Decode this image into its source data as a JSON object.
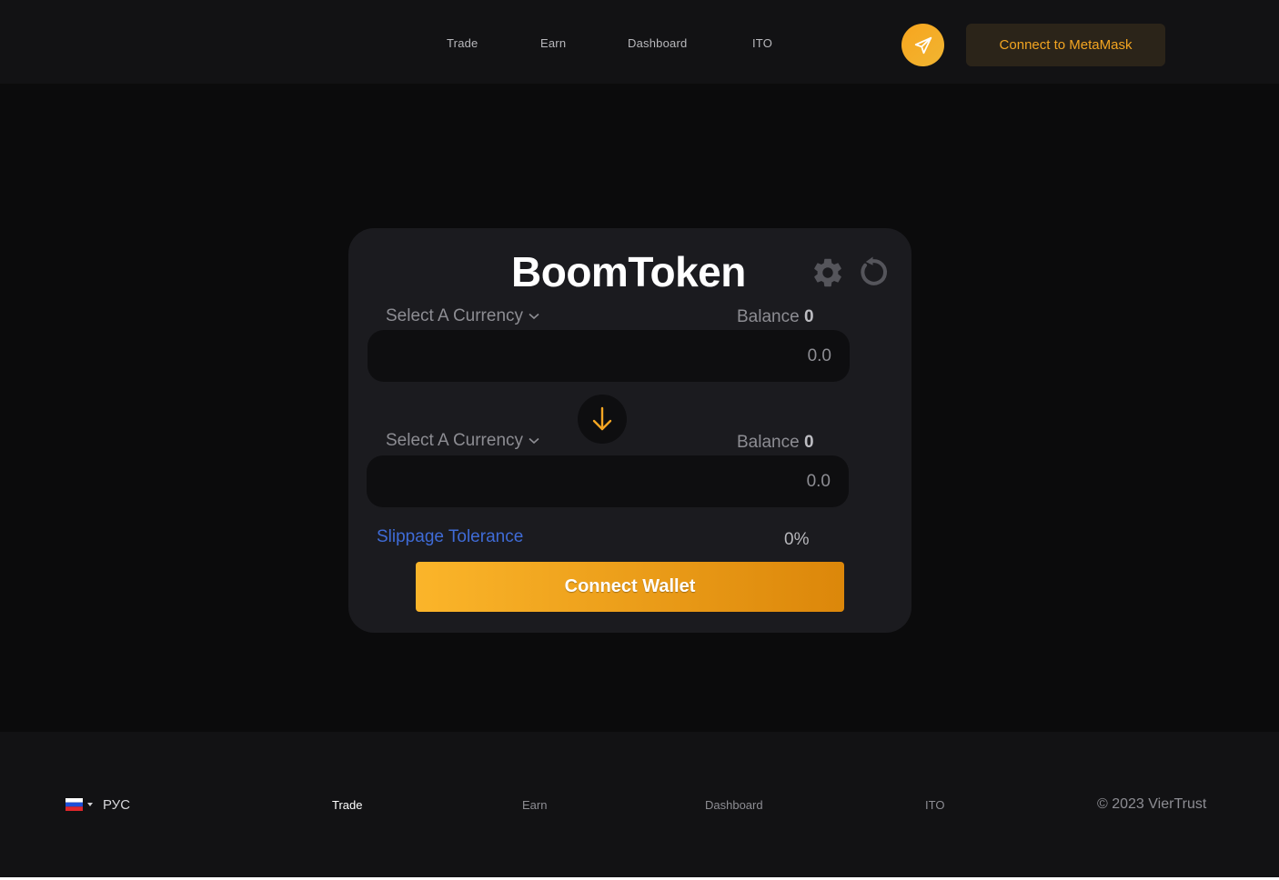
{
  "header": {
    "nav": [
      "Trade",
      "Earn",
      "Dashboard",
      "ITO"
    ],
    "telegram_icon": "paper-plane-icon",
    "connect_metamask": "Connect to MetaMask"
  },
  "swap": {
    "title": "BoomToken",
    "settings_icon": "gear-icon",
    "refresh_icon": "refresh-icon",
    "from": {
      "select_label": "Select A Currency",
      "balance_label": "Balance",
      "balance_value": "0",
      "amount": "0.0"
    },
    "to": {
      "select_label": "Select A Currency",
      "balance_label": "Balance",
      "balance_value": "0",
      "amount": "0.0"
    },
    "swap_icon": "arrow-down-icon",
    "slippage_label": "Slippage Tolerance",
    "slippage_value": "0%",
    "connect_wallet": "Connect Wallet"
  },
  "footer": {
    "language": "РУС",
    "nav": [
      "Trade",
      "Earn",
      "Dashboard",
      "ITO"
    ],
    "copyright": "© 2023 VierTrust"
  },
  "colors": {
    "accent": "#f5a623",
    "link_blue": "#3f6bd6",
    "background": "#0b0b0c",
    "card": "#1b1b1f"
  }
}
